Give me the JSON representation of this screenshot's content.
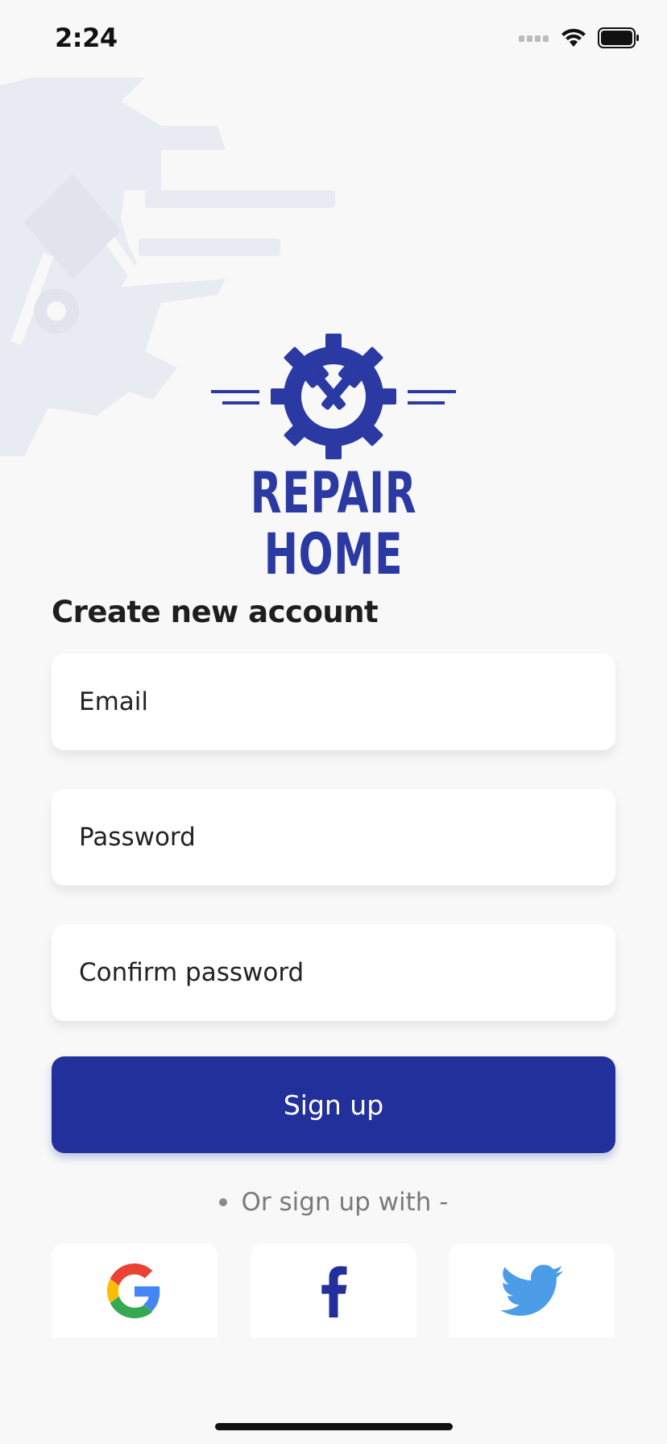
{
  "status": {
    "time": "2:24"
  },
  "brand": {
    "name": "REPAIR HOME",
    "color": "#2b3aa3"
  },
  "form": {
    "heading": "Create new account",
    "email_placeholder": "Email",
    "password_placeholder": "Password",
    "confirm_placeholder": "Confirm password",
    "submit_label": "Sign up",
    "divider_text": "Or sign up with -"
  },
  "social": [
    {
      "icon": "google-icon"
    },
    {
      "icon": "facebook-icon",
      "color": "#21309b"
    },
    {
      "icon": "twitter-icon",
      "color": "#4a9de6"
    }
  ],
  "colors": {
    "accent": "#21309b",
    "background": "#f8f8f9"
  }
}
